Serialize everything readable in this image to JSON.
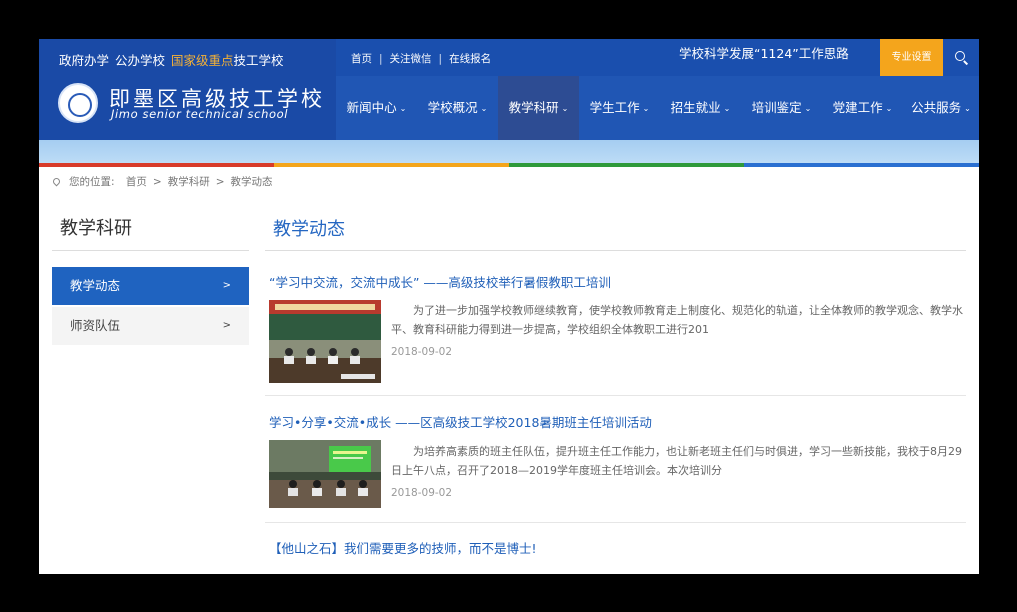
{
  "brand": {
    "tag_1": "政府办学",
    "tag_2": "公办学校",
    "tag_3": "国家级重点",
    "tag_4": "技工学校",
    "school_cn": "即墨区高级技工学校",
    "school_en": "Jimo senior technical school"
  },
  "toplinks": [
    "首页",
    "关注微信",
    "在线报名"
  ],
  "slogan": "学校科学发展“1124”工作思路",
  "pro_button": "专业设置",
  "nav": [
    {
      "label": "新闻中心",
      "active": false
    },
    {
      "label": "学校概况",
      "active": false
    },
    {
      "label": "教学科研",
      "active": true
    },
    {
      "label": "学生工作",
      "active": false
    },
    {
      "label": "招生就业",
      "active": false
    },
    {
      "label": "培训鉴定",
      "active": false
    },
    {
      "label": "党建工作",
      "active": false
    },
    {
      "label": "公共服务",
      "active": false
    }
  ],
  "breadcrumb": {
    "prefix": "您的位置:",
    "items": [
      "首页",
      "教学科研",
      "教学动态"
    ]
  },
  "sidebar": {
    "title": "教学科研",
    "items": [
      {
        "label": "教学动态",
        "active": true
      },
      {
        "label": "师资队伍",
        "active": false
      }
    ]
  },
  "main": {
    "title": "教学动态",
    "articles": [
      {
        "title": "“学习中交流，交流中成长” ——高级技校举行暑假教职工培训",
        "desc": "为了进一步加强学校教师继续教育，使学校教师教育走上制度化、规范化的轨道，让全体教师的教学观念、教学水平、教育科研能力得到进一步提高，学校组织全体教职工进行201",
        "date": "2018-09-02"
      },
      {
        "title": "学习•分享•交流•成长 ——区高级技工学校2018暑期班主任培训活动",
        "desc": "为培养高素质的班主任队伍，提升班主任工作能力，也让新老班主任们与时俱进，学习一些新技能，我校于8月29日上午八点，召开了2018—2019学年度班主任培训会。本次培训分",
        "date": "2018-09-02"
      },
      {
        "title": "【他山之石】我们需要更多的技师，而不是博士!",
        "desc": "",
        "date": ""
      }
    ]
  },
  "colors": {
    "header_blue": "#1a4fae",
    "nav_active": "#2d4c93",
    "accent_orange": "#f4a51c",
    "link_blue": "#1f5fb8",
    "sidebar_active": "#1f63c0"
  }
}
